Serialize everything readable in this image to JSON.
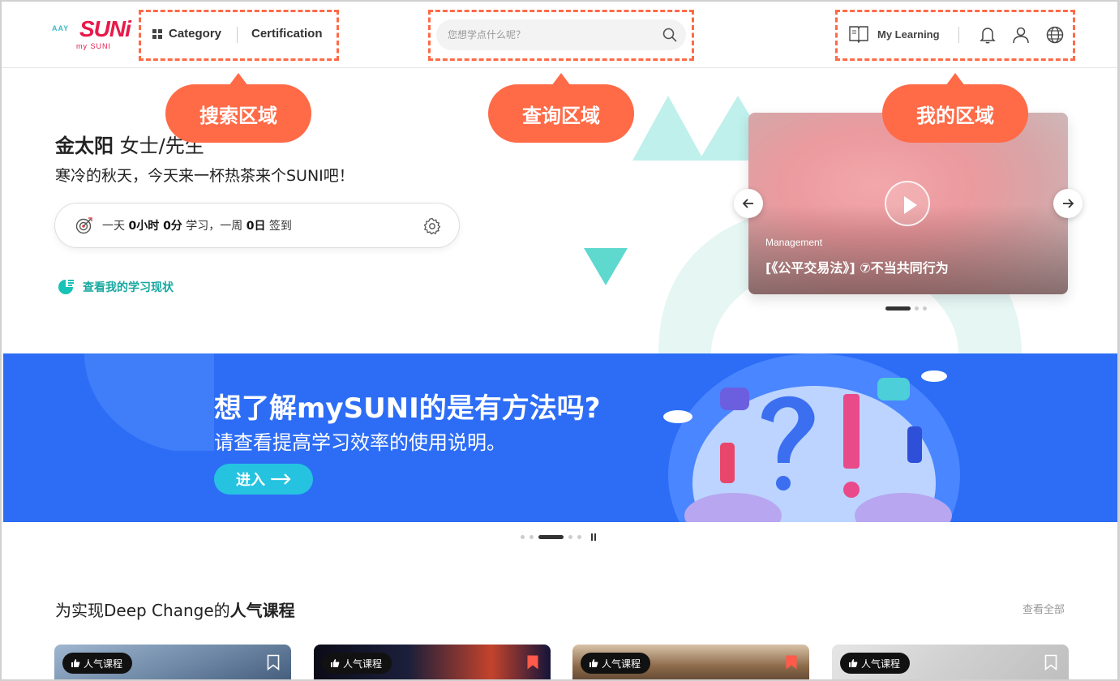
{
  "header": {
    "logo": {
      "brand": "SUNi",
      "sub": "my SUNI",
      "people": "AAY"
    },
    "nav": {
      "category_label": "Category",
      "certification_label": "Certification"
    },
    "search": {
      "placeholder": "您想学点什么呢？"
    },
    "mine": {
      "my_learning_label": "My Learning"
    }
  },
  "callouts": {
    "search_area": "搜索区域",
    "query_area": "查询区域",
    "my_area": "我的区域"
  },
  "hero": {
    "name": "金太阳",
    "name_suffix": " 女士/先生",
    "greeting": "寒冷的秋天，今天来一杯热茶来个SUNI吧！",
    "stats": {
      "t1": "一天 ",
      "hours": "0小时 0分",
      "t2": " 学习，一周 ",
      "days": "0日",
      "t3": " 签到"
    },
    "status_link": "查看我的学习现状"
  },
  "featured": {
    "category": "Management",
    "title": "[《公平交易法》] ⑦不当共同行为",
    "active_slide": 1,
    "slide_count": 3
  },
  "banner": {
    "title": "想了解mySUNI的是有方法吗?",
    "subtitle": "请查看提高学习效率的使用说明。",
    "enter_label": "进入",
    "active_slide": 3,
    "slide_count": 5
  },
  "popular": {
    "title_prefix": "为实现Deep Change的",
    "title_bold": "人气课程",
    "view_all": "查看全部",
    "cards": [
      {
        "badge": "人气课程",
        "bookmarked": false
      },
      {
        "badge": "人气课程",
        "bookmarked": true
      },
      {
        "badge": "人气课程",
        "bookmarked": true
      },
      {
        "badge": "人气课程",
        "bookmarked": false
      }
    ]
  },
  "colors": {
    "accent": "#ff6a47",
    "brand": "#e8194a",
    "teal": "#17a8a0",
    "banner": "#2d6df6",
    "enter_button": "#25c3e0"
  }
}
